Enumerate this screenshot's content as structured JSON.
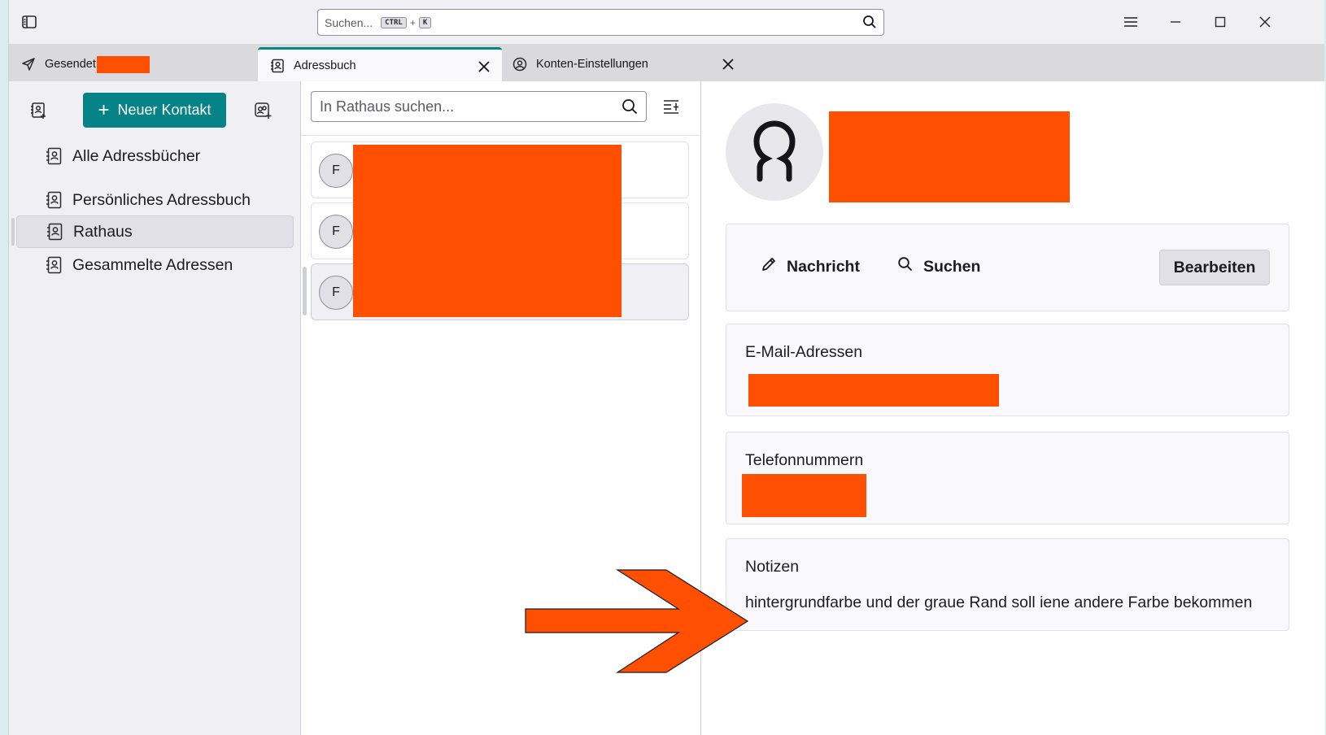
{
  "topbar": {
    "search_placeholder": "Suchen...",
    "shortcut_ctrl": "CTRL",
    "shortcut_plus": "+",
    "shortcut_key": "K"
  },
  "tabs": [
    {
      "label": "Gesendet",
      "icon": "send-icon"
    },
    {
      "label": "Adressbuch",
      "icon": "address-book-icon",
      "active": true
    },
    {
      "label": "Konten-Einstellungen",
      "icon": "account-settings-icon"
    }
  ],
  "sidebar": {
    "new_contact_label": "Neuer Kontakt",
    "books": [
      {
        "label": "Alle Adressbücher"
      },
      {
        "label": "Persönliches Adressbuch"
      },
      {
        "label": "Rathaus",
        "selected": true
      },
      {
        "label": "Gesammelte Adressen"
      }
    ]
  },
  "list": {
    "search_placeholder": "In Rathaus suchen...",
    "contacts": [
      {
        "initial": "F"
      },
      {
        "initial": "F"
      },
      {
        "initial": "F",
        "selected": true
      }
    ]
  },
  "detail": {
    "actions": {
      "message_label": "Nachricht",
      "search_label": "Suchen",
      "edit_label": "Bearbeiten"
    },
    "email_title": "E-Mail-Adressen",
    "phone_title": "Telefonnummern",
    "notes_title": "Notizen",
    "notes_text": "hintergrundfarbe und der graue Rand soll iene andere Farbe bekommen"
  },
  "colors": {
    "accent": "#068387",
    "redaction": "#ff4f00",
    "annotation_arrow": "#ff4f00"
  }
}
